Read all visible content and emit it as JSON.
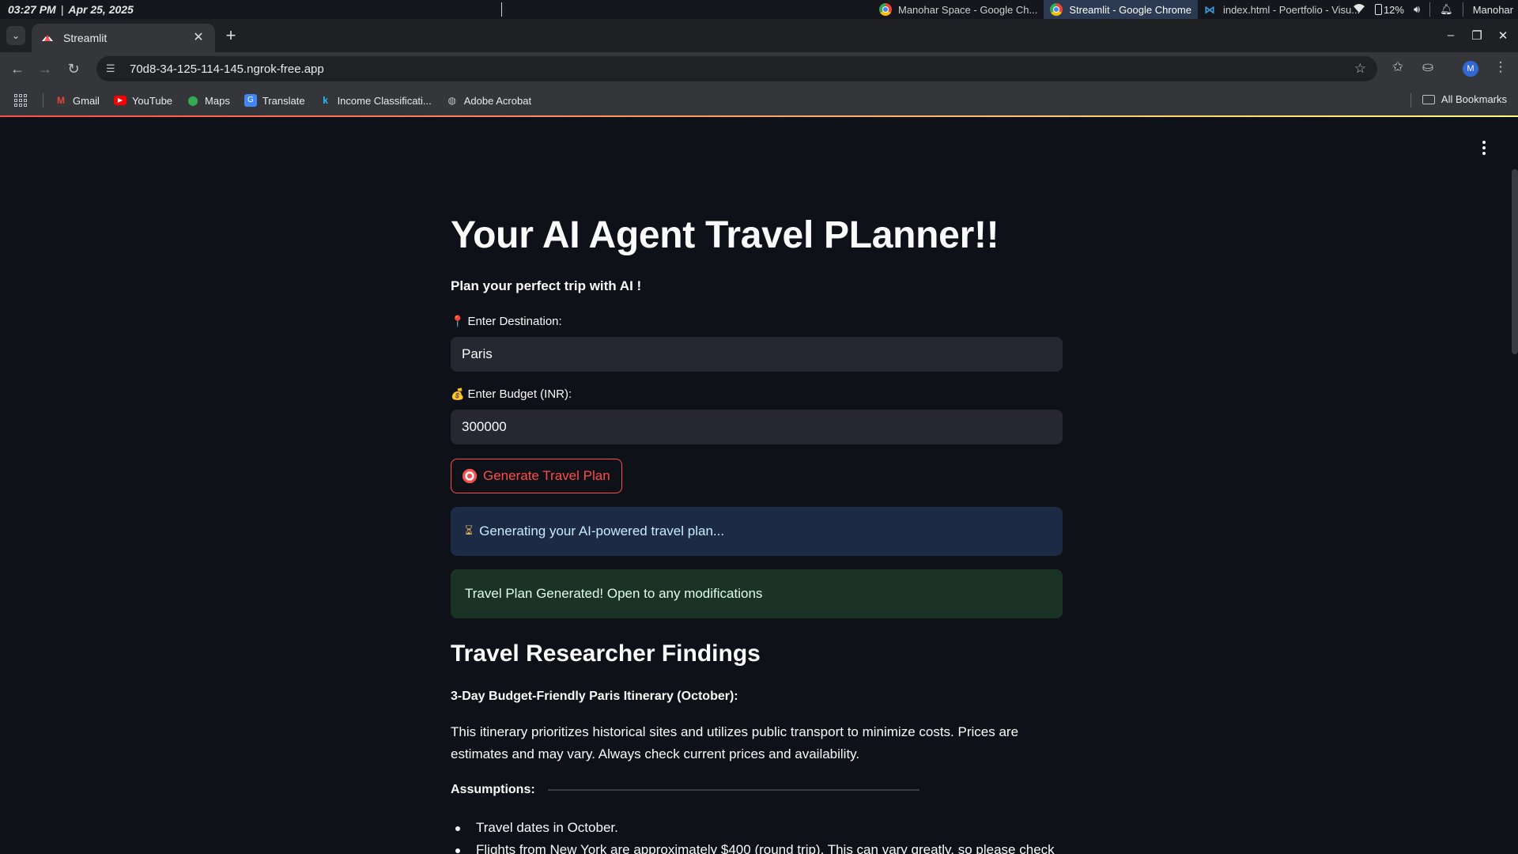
{
  "os": {
    "time": "03:27 PM",
    "date": "Apr 25, 2025",
    "tasks": [
      {
        "label": "Manohar Space - Google Ch...",
        "icon": "chrome-icon",
        "active": false
      },
      {
        "label": "Streamlit - Google Chrome",
        "icon": "chrome-icon",
        "active": true
      },
      {
        "label": "index.html - Poertfolio - Visu...",
        "icon": "vscode-icon",
        "active": false
      }
    ],
    "battery": "12%",
    "user": "Manohar"
  },
  "browser": {
    "tab_title": "Streamlit",
    "url": "70d8-34-125-114-145.ngrok-free.app",
    "profile_initial": "M",
    "bookmarks": [
      {
        "label": "Gmail",
        "icon": "gmail-icon"
      },
      {
        "label": "YouTube",
        "icon": "youtube-icon"
      },
      {
        "label": "Maps",
        "icon": "maps-icon"
      },
      {
        "label": "Translate",
        "icon": "translate-icon"
      },
      {
        "label": "Income Classificati...",
        "icon": "kaggle-icon"
      },
      {
        "label": "Adobe Acrobat",
        "icon": "globe-icon"
      }
    ],
    "all_bookmarks": "All Bookmarks"
  },
  "app": {
    "title": "Your AI Agent Travel PLanner!!",
    "subtitle": "Plan your perfect trip with AI !",
    "destination_label": "Enter Destination:",
    "destination_emoji": "📍",
    "destination_value": "Paris",
    "budget_label": "Enter Budget (INR):",
    "budget_emoji": "💰",
    "budget_value": "300000",
    "generate_button": "Generate Travel Plan",
    "info_message": "Generating your AI-powered travel plan...",
    "success_message": "Travel Plan Generated! Open to any modifications",
    "findings_heading": "Travel Researcher Findings",
    "itinerary_heading": "3-Day Budget-Friendly Paris Itinerary (October):",
    "intro_paragraph": "This itinerary prioritizes historical sites and utilizes public transport to minimize costs. Prices are estimates and may vary. Always check current prices and availability.",
    "assumptions_heading": "Assumptions:",
    "assumptions": [
      "Travel dates in October.",
      "Flights from New York are approximately $400 (round trip). This can vary greatly, so please check"
    ]
  }
}
